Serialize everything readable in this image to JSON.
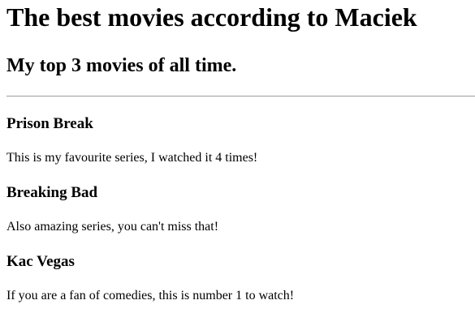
{
  "page": {
    "title": "The best movies according to Maciek",
    "subtitle": "My top 3 movies of all time."
  },
  "movies": [
    {
      "title": "Prison Break",
      "description": "This is my favourite series, I watched it 4 times!"
    },
    {
      "title": "Breaking Bad",
      "description": "Also amazing series, you can't miss that!"
    },
    {
      "title": "Kac Vegas",
      "description": "If you are a fan of comedies, this is number 1 to watch!"
    }
  ]
}
